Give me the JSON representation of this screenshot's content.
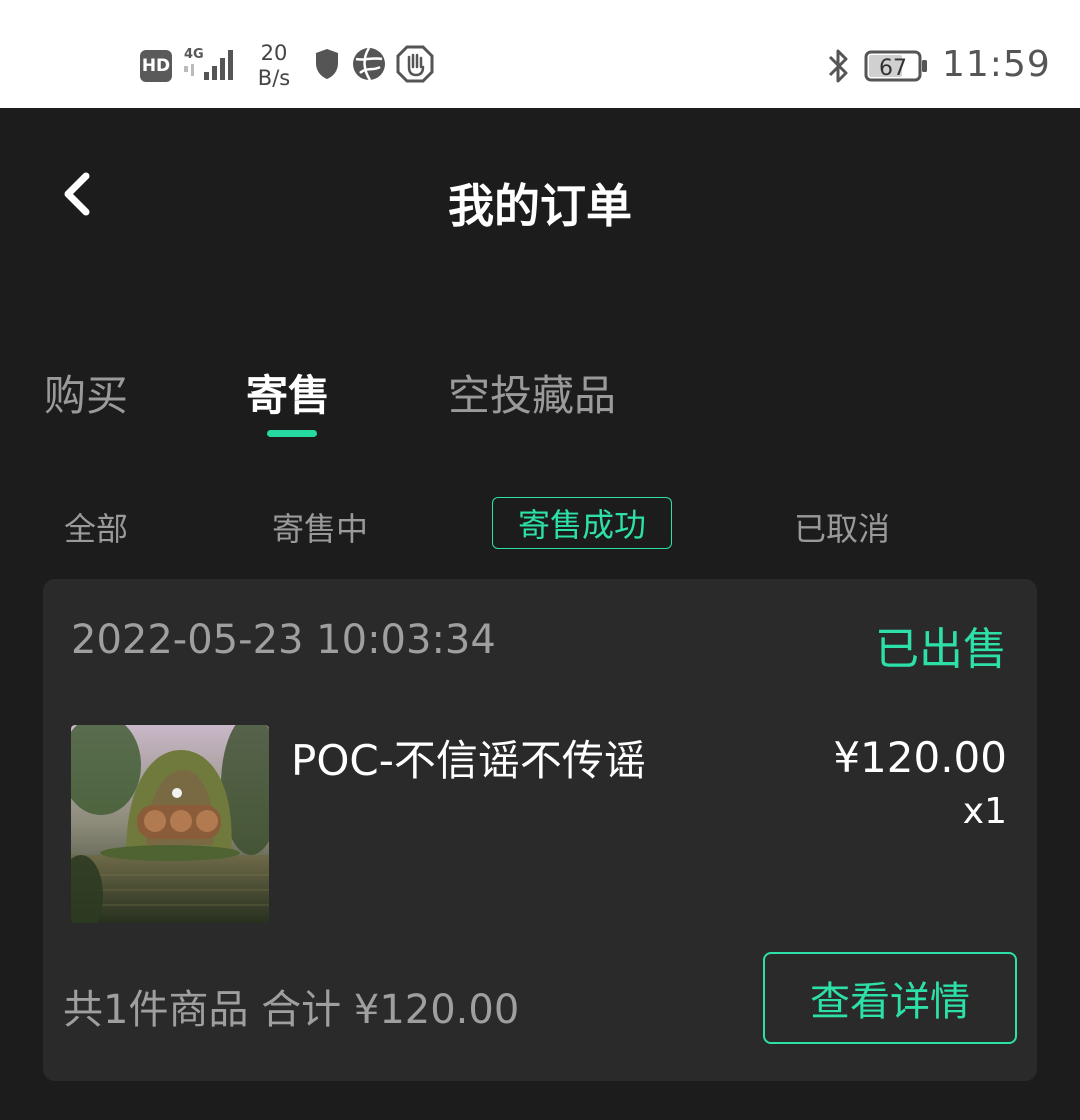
{
  "status_bar": {
    "hd": "HD",
    "network": "4G",
    "speed_value": "20",
    "speed_unit": "B/s",
    "battery": "67",
    "time": "11:59",
    "icons": [
      "hd-icon",
      "4g-signal-icon",
      "shield-icon",
      "globe-icon",
      "hand-stop-icon",
      "bluetooth-icon",
      "battery-icon"
    ]
  },
  "header": {
    "title": "我的订单",
    "back_icon": "chevron-left-icon"
  },
  "tabs": [
    {
      "label": "购买",
      "active": false
    },
    {
      "label": "寄售",
      "active": true
    },
    {
      "label": "空投藏品",
      "active": false
    }
  ],
  "subtabs": [
    {
      "label": "全部",
      "active": false
    },
    {
      "label": "寄售中",
      "active": false
    },
    {
      "label": "寄售成功",
      "active": true
    },
    {
      "label": "已取消",
      "active": false
    }
  ],
  "order": {
    "datetime": "2022-05-23 10:03:34",
    "status": "已出售",
    "product_name": "POC-不信谣不传谣",
    "price": "¥120.00",
    "quantity": "x1",
    "summary": "共1件商品 合计 ¥120.00",
    "detail_button": "查看详情"
  },
  "colors": {
    "accent": "#2de0a8",
    "background": "#1c1c1c",
    "card": "#2a2a2a"
  }
}
